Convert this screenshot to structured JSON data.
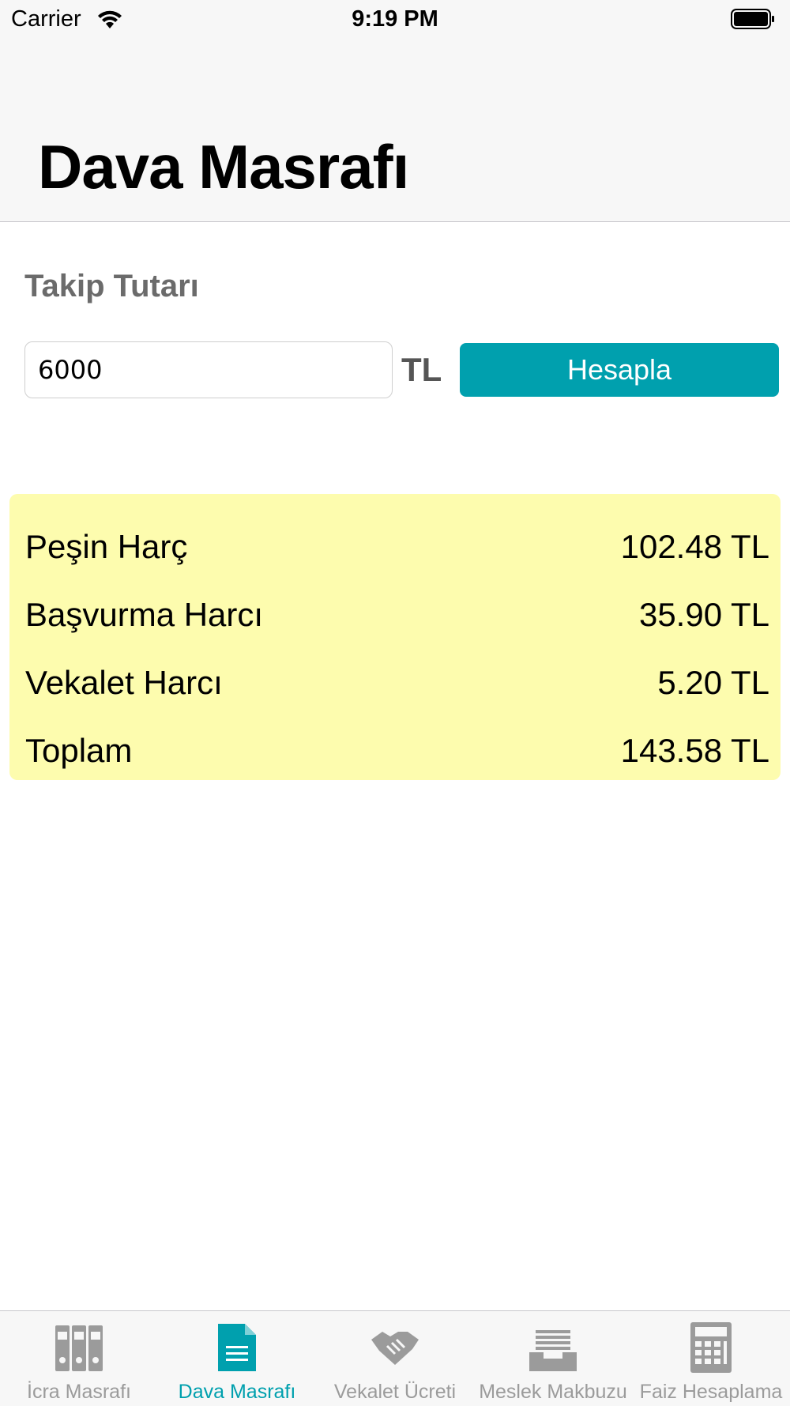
{
  "status_bar": {
    "carrier": "Carrier",
    "time": "9:19 PM"
  },
  "header": {
    "title": "Dava Masrafı"
  },
  "form": {
    "label": "Takip Tutarı",
    "amount_value": "6000",
    "currency": "TL",
    "button_label": "Hesapla"
  },
  "results": [
    {
      "label": "Peşin Harç",
      "value": "102.48 TL"
    },
    {
      "label": "Başvurma Harcı",
      "value": "35.90 TL"
    },
    {
      "label": "Vekalet Harcı",
      "value": "5.20 TL"
    },
    {
      "label": "Toplam",
      "value": "143.58 TL"
    }
  ],
  "tabs": [
    {
      "label": "İcra Masrafı",
      "icon": "binders-icon",
      "active": false
    },
    {
      "label": "Dava Masrafı",
      "icon": "document-icon",
      "active": true
    },
    {
      "label": "Vekalet Ücreti",
      "icon": "handshake-icon",
      "active": false
    },
    {
      "label": "Meslek Makbuzu",
      "icon": "inbox-tray-icon",
      "active": false
    },
    {
      "label": "Faiz Hesaplama",
      "icon": "calculator-icon",
      "active": false
    }
  ],
  "colors": {
    "accent": "#00a0ae",
    "results_background": "#fdfcae",
    "inactive_tab": "#9b9b9b"
  }
}
